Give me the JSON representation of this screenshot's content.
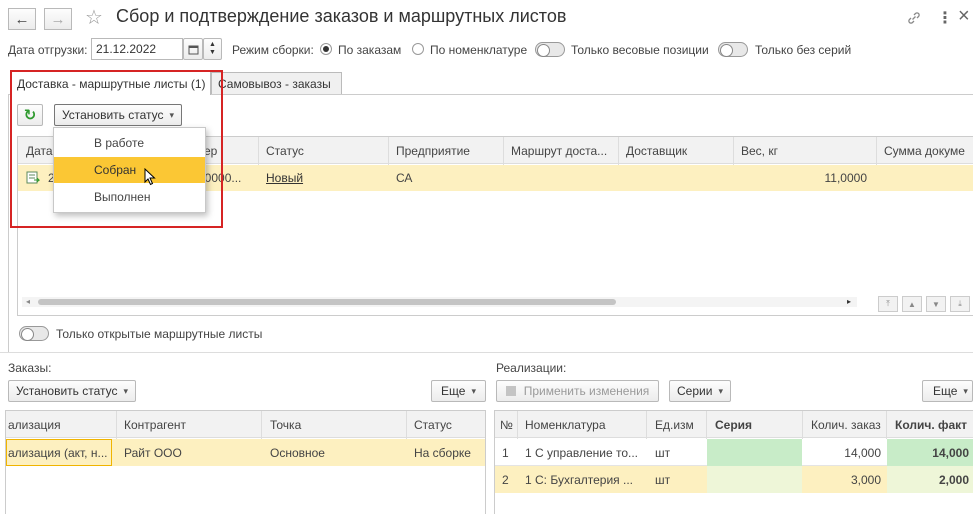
{
  "window": {
    "title": "Сбор и подтверждение заказов и маршрутных листов",
    "back_icon": "←",
    "forward_icon": "→",
    "star_icon": "☆",
    "link_icon": "🔗",
    "more_icon": "⋮",
    "close_icon": "×"
  },
  "filters": {
    "date_label": "Дата отгрузки:",
    "date_value": "21.12.2022",
    "mode_label": "Режим сборки:",
    "mode_by_orders": "По заказам",
    "mode_by_items": "По номенклатуре",
    "weight_only": "Только весовые позиции",
    "no_series": "Только без серий"
  },
  "tabs": {
    "delivery": "Доставка - маршрутные листы (1)",
    "pickup": "Самовывоз - заказы"
  },
  "toolbar": {
    "refresh_icon": "↻",
    "set_status": "Установить статус"
  },
  "status_menu": {
    "items": [
      "В работе",
      "Собран",
      "Выполнен"
    ]
  },
  "route_grid": {
    "headers": [
      "Дата",
      "ер",
      "Статус",
      "Предприятие",
      "Маршрут доста...",
      "Доставщик",
      "Вес, кг",
      "Сумма докуме"
    ],
    "row": {
      "date": "2",
      "number": "00000...",
      "status": "Новый",
      "company": "СА",
      "route": "",
      "carrier": "",
      "weight": "11,0000",
      "sum": ""
    }
  },
  "open_only": "Только открытые маршрутные листы",
  "orders": {
    "section_label": "Заказы:",
    "set_status": "Установить статус",
    "more": "Еще",
    "headers": [
      "ализация",
      "Контрагент",
      "Точка",
      "Статус"
    ],
    "row": [
      "ализация (акт, н...",
      "Райт ООО",
      "Основное",
      "На сборке"
    ]
  },
  "sales": {
    "section_label": "Реализации:",
    "apply": "Применить изменения",
    "series": "Серии",
    "more": "Еще",
    "headers": [
      "№",
      "Номенклатура",
      "Ед.изм",
      "Серия",
      "Колич. заказ",
      "Колич. факт"
    ],
    "rows": [
      [
        "1",
        "1 С управление то...",
        "шт",
        "",
        "14,000",
        "14,000"
      ],
      [
        "2",
        "1 С:  Бухгалтерия ...",
        "шт",
        "",
        "3,000",
        "2,000"
      ]
    ]
  },
  "colors": {
    "highlight": "#fdf0c0",
    "menu_selected": "#fbc734",
    "series_green": "#d4f0d4",
    "frame_red": "#d62424"
  }
}
